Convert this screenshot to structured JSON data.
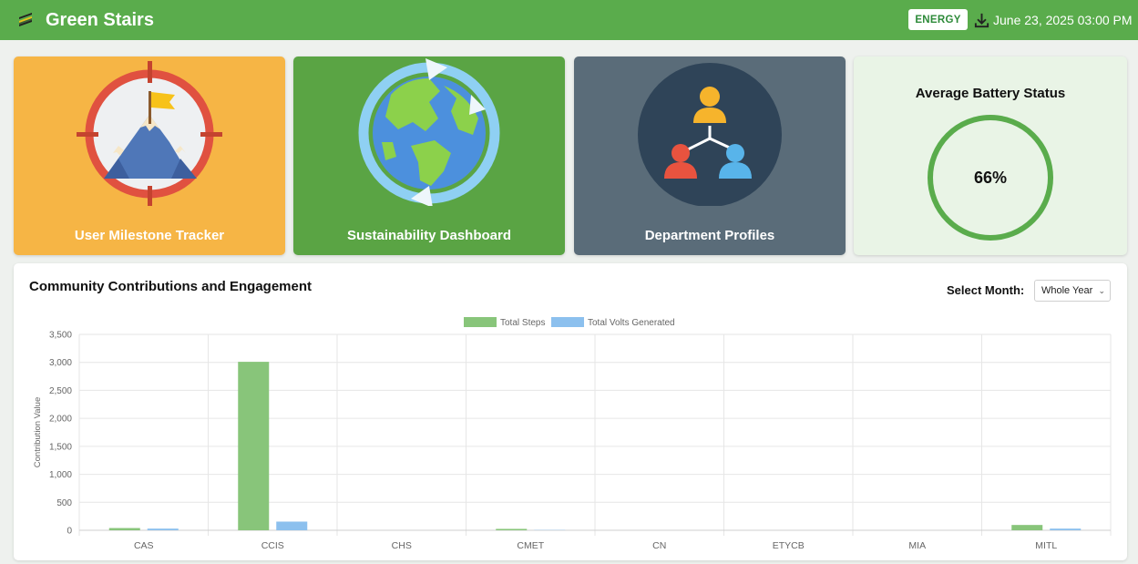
{
  "header": {
    "title": "Green Stairs",
    "badge": "ENERGY",
    "datetime": "June 23, 2025 03:00 PM"
  },
  "cards": [
    {
      "label": "User Milestone Tracker",
      "color": "#f6b545",
      "icon": "mountain-flag-target-icon"
    },
    {
      "label": "Sustainability Dashboard",
      "color": "#5aa444",
      "icon": "recycle-globe-icon"
    },
    {
      "label": "Department Profiles",
      "color": "#5a6c79",
      "icon": "org-chart-people-icon"
    }
  ],
  "battery": {
    "title": "Average Battery Status",
    "value_label": "66%",
    "percent": 66,
    "ring_color": "#5aac4c"
  },
  "chart_panel": {
    "title": "Community Contributions and Engagement",
    "month_label": "Select Month:",
    "month_value": "Whole Year"
  },
  "chart_data": {
    "type": "bar",
    "categories": [
      "CAS",
      "CCIS",
      "CHS",
      "CMET",
      "CN",
      "ETYCB",
      "MIA",
      "MITL"
    ],
    "series": [
      {
        "name": "Total Steps",
        "color": "#88c57a",
        "values": [
          40,
          3010,
          0,
          25,
          0,
          0,
          0,
          95
        ]
      },
      {
        "name": "Total Volts Generated",
        "color": "#8cc0ee",
        "values": [
          30,
          155,
          0,
          5,
          0,
          0,
          0,
          30
        ]
      }
    ],
    "ylabel": "Contribution Value",
    "ylim": [
      0,
      3500
    ],
    "yticks": [
      0,
      500,
      1000,
      1500,
      2000,
      2500,
      3000,
      3500
    ],
    "ytick_labels": [
      "0",
      "500",
      "1,000",
      "1,500",
      "2,000",
      "2,500",
      "3,000",
      "3,500"
    ],
    "legend": "top-center",
    "grid": true
  }
}
